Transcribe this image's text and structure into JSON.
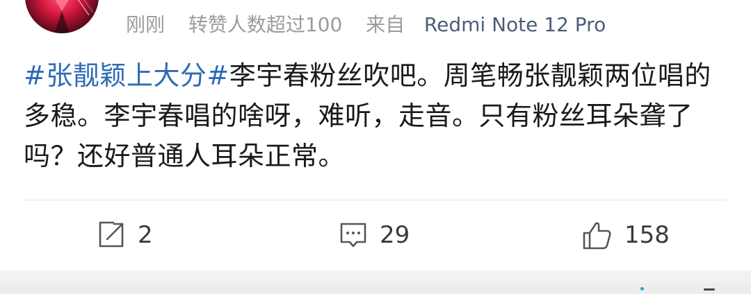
{
  "post": {
    "time": "刚刚",
    "repost_note": "转赞人数超过100",
    "source_prefix": "来自",
    "device": "Redmi Note 12 Pro",
    "topic": "#张靓颖上大分#",
    "body": "李宇春粉丝吹吧。周笔畅张靓颖两位唱的多稳。李宇春唱的啥呀，难听，走音。只有粉丝耳朵聋了吗？还好普通人耳朵正常。"
  },
  "actions": {
    "repost_count": "2",
    "comment_count": "29",
    "like_count": "158"
  },
  "icons": {
    "repost": "share-icon",
    "comment": "comment-icon",
    "like": "thumbs-up-icon"
  },
  "colors": {
    "topic": "#2e6bb5",
    "meta": "#9b9b9b",
    "device": "#4a5d79"
  }
}
